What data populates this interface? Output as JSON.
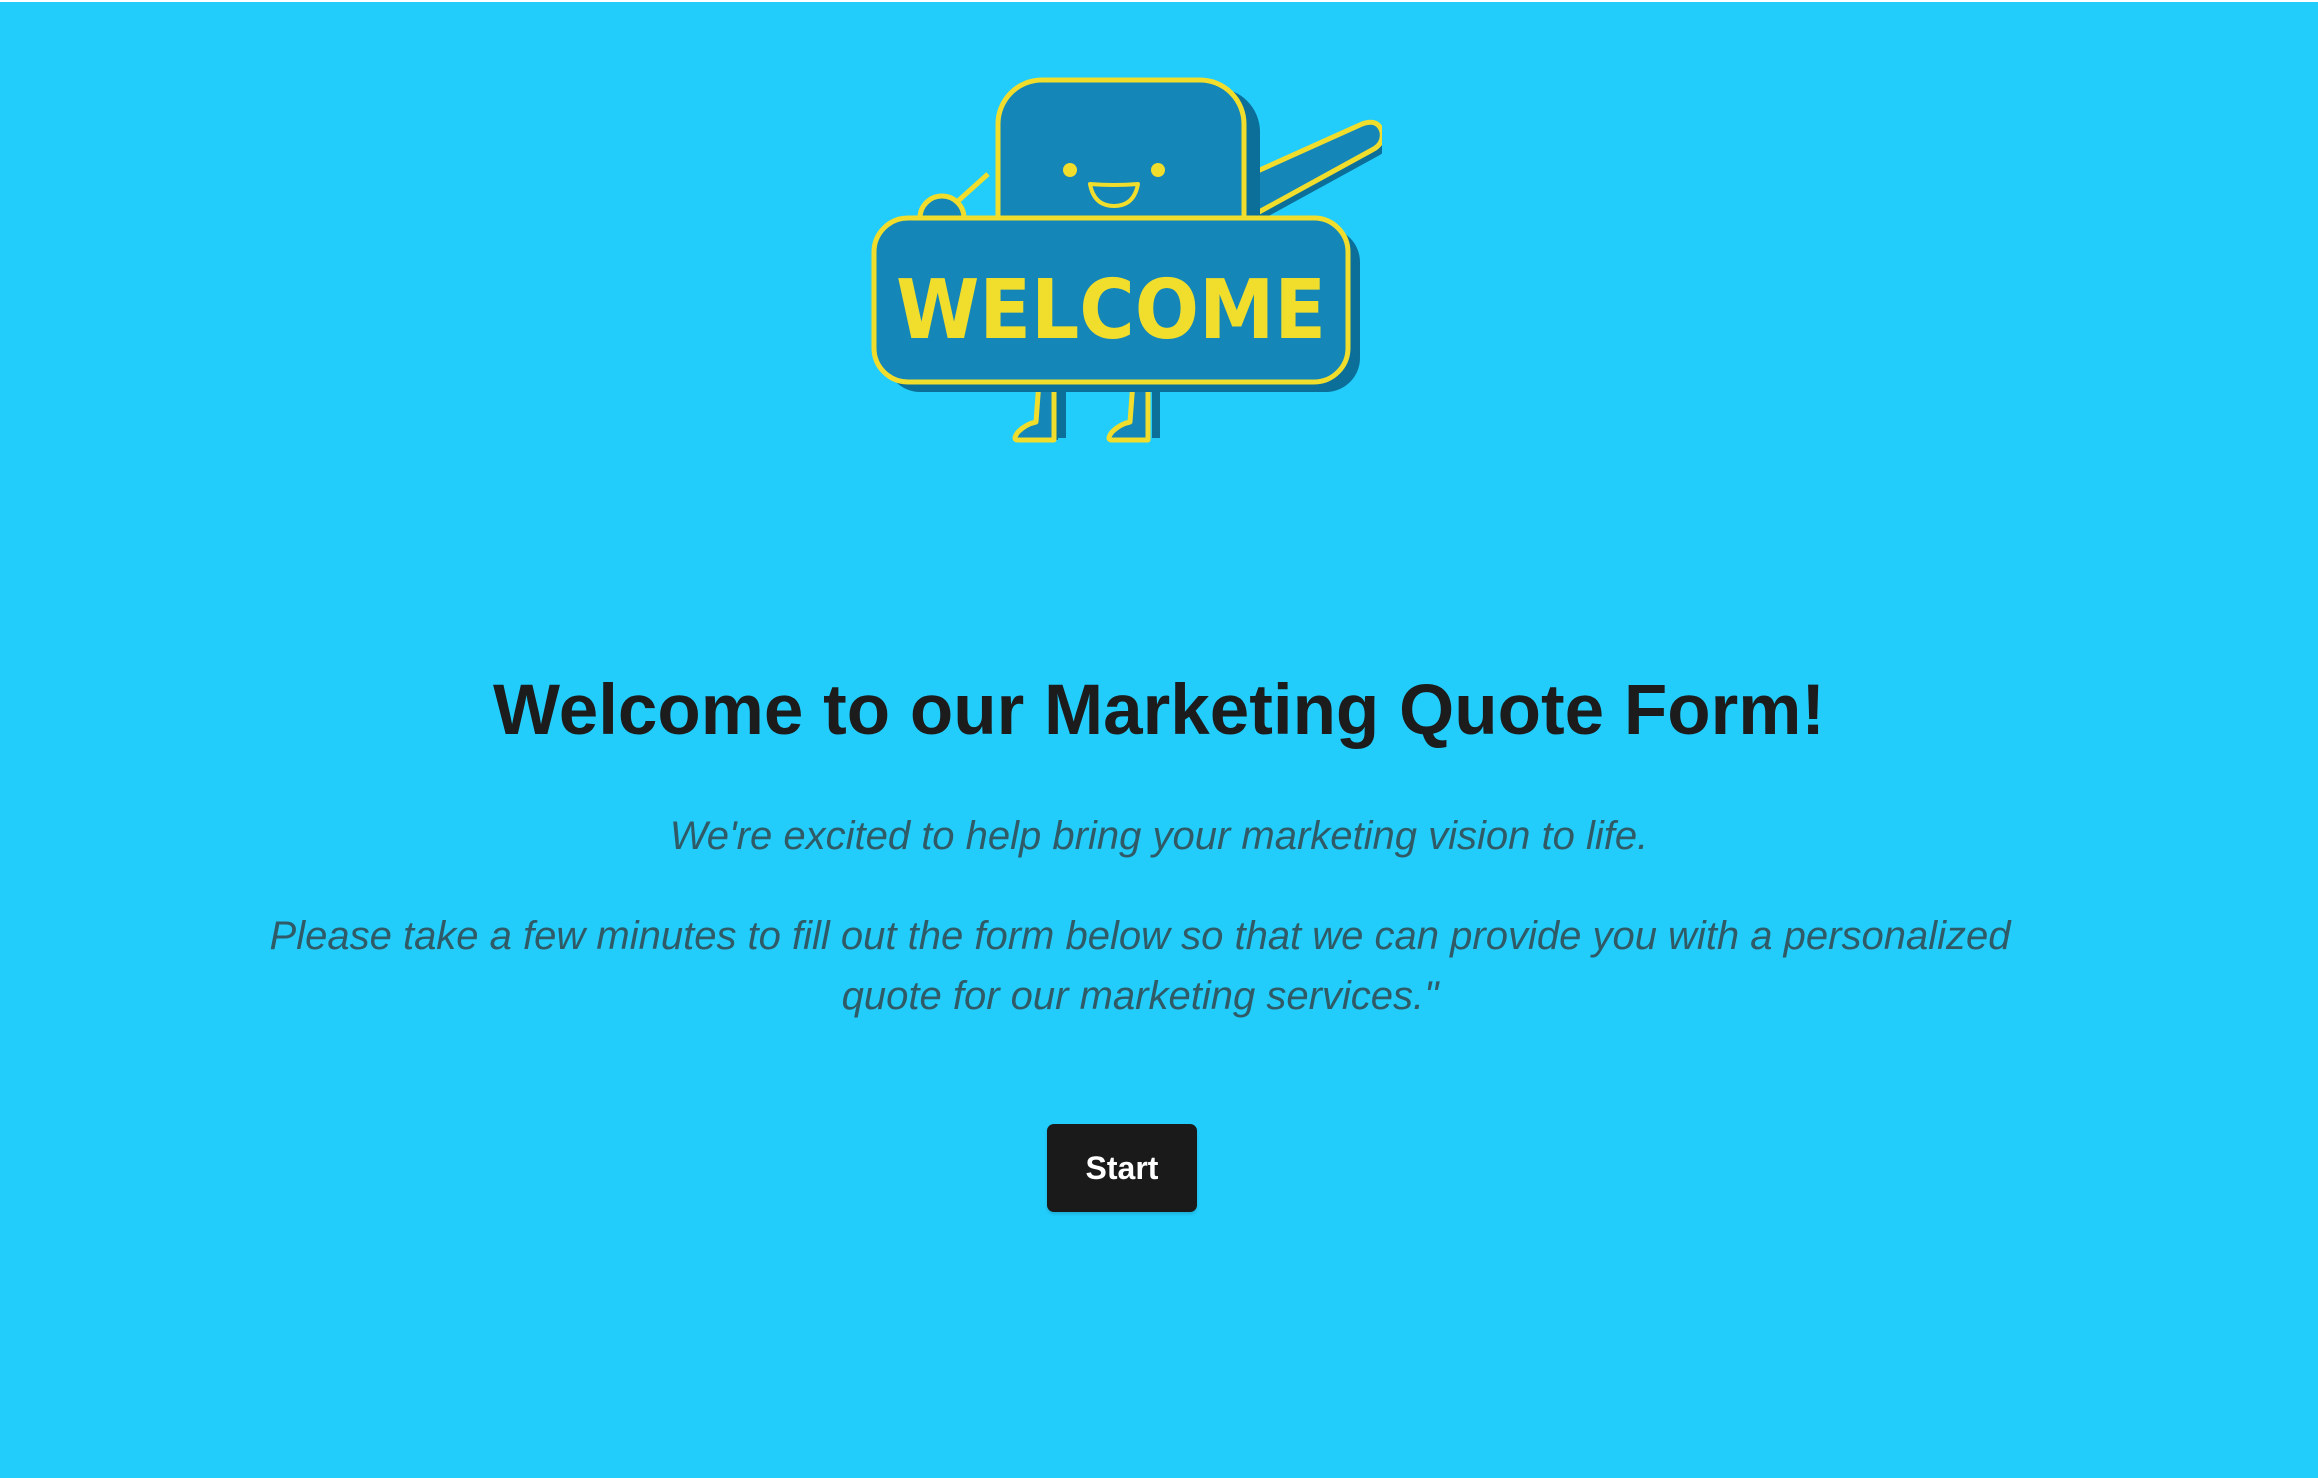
{
  "hero": {
    "sign_text": "WELCOME",
    "colors": {
      "body": "#1486b8",
      "outline": "#f1dd2c",
      "shadow": "#0b6f9a"
    }
  },
  "heading": {
    "title": "Welcome to our Marketing Quote Form!",
    "subtitle": "We're excited to help bring your marketing vision to life.",
    "description": "Please take a few minutes to fill out the form below so that we can provide you with a personalized quote for our marketing services.\""
  },
  "actions": {
    "start_label": "Start"
  },
  "theme": {
    "background": "#22cdfc",
    "title_color": "#1c1c1c",
    "text_color": "#2f5a66",
    "button_color": "#1a1a1a"
  }
}
